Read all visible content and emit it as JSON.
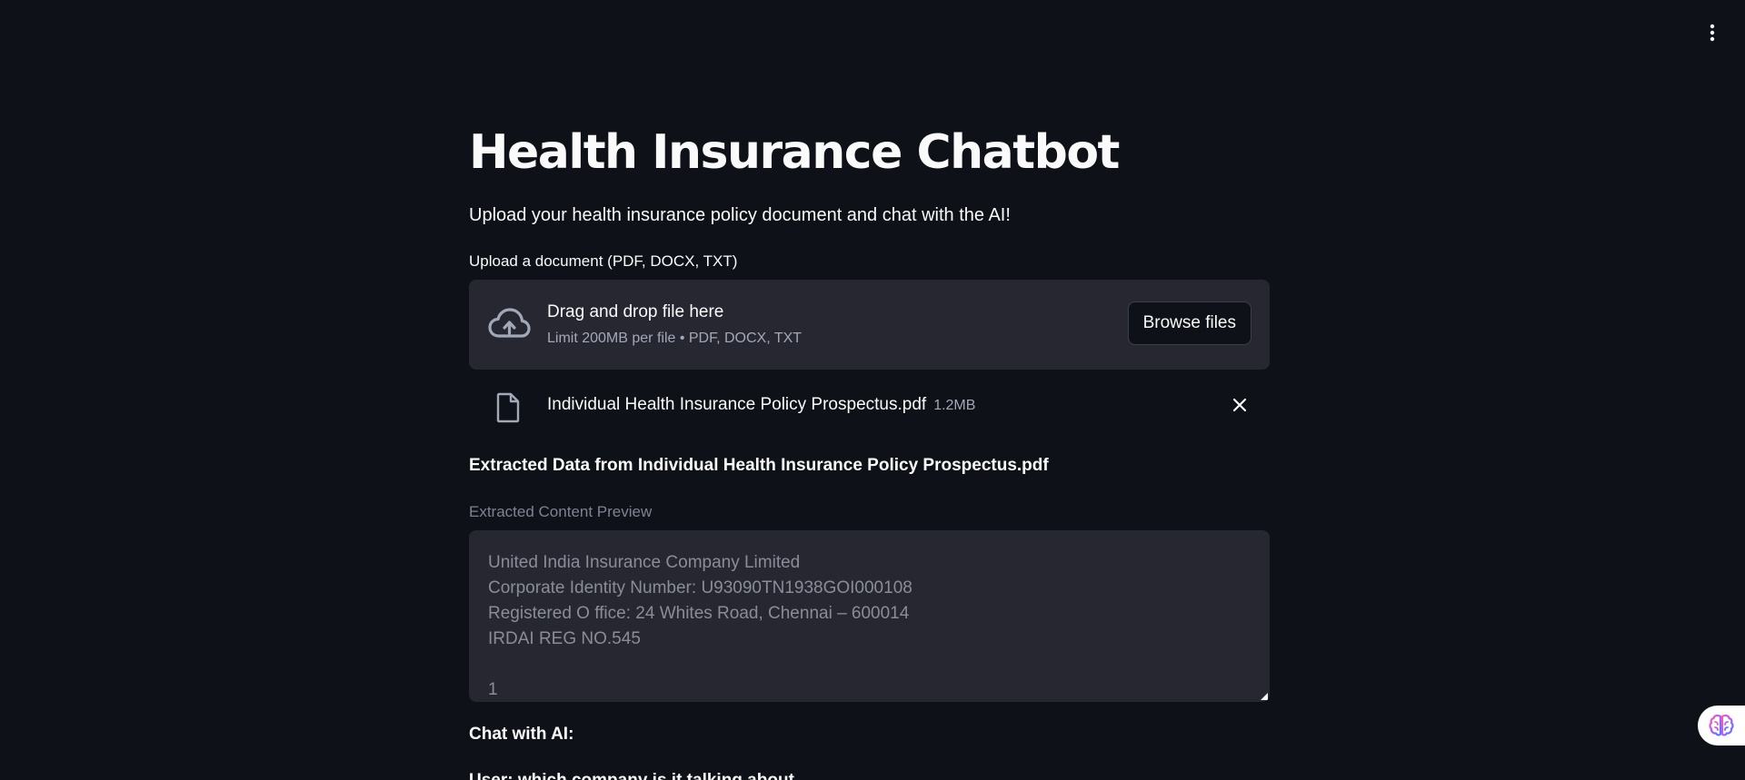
{
  "header": {
    "menu_icon": "more-vertical-icon"
  },
  "main": {
    "title": "Health Insurance Chatbot",
    "subtitle": "Upload your health insurance policy document and chat with the AI!",
    "uploader": {
      "label": "Upload a document (PDF, DOCX, TXT)",
      "dropzone_text": "Drag and drop file here",
      "dropzone_hint": "Limit 200MB per file • PDF, DOCX, TXT",
      "browse_label": "Browse files",
      "icon": "cloud-upload-icon"
    },
    "uploaded_file": {
      "name": "Individual Health Insurance Policy Prospectus.pdf",
      "size": "1.2MB",
      "icon": "file-icon",
      "remove_icon": "close-icon"
    },
    "extracted": {
      "heading": "Extracted Data from Individual Health Insurance Policy Prospectus.pdf",
      "preview_label": "Extracted Content Preview",
      "preview_lines": [
        "United India Insurance Company Limited",
        "Corporate Identity Number: U93090TN1938GOI000108",
        "Registered O ffice: 24 Whites Road, Chennai – 600014",
        "IRDAI REG NO.545",
        "",
        "1"
      ]
    },
    "chat": {
      "heading": "Chat with AI:",
      "user_message": "User: which company is it talking about"
    }
  },
  "floating_action": {
    "icon": "brain-icon"
  },
  "colors": {
    "background": "#0e1117",
    "surface": "#262730",
    "text": "#fafafa",
    "muted": "#a3a8b8"
  }
}
